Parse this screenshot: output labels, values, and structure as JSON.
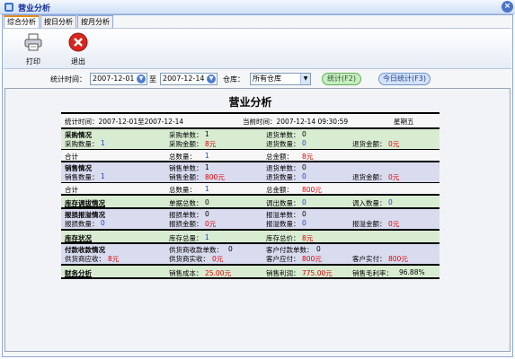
{
  "window": {
    "title": "营业分析"
  },
  "tabs": [
    "综合分析",
    "按日分析",
    "按月分析"
  ],
  "toolbar": {
    "print": "打印",
    "exit": "退出"
  },
  "filter": {
    "time_label": "统计时间：",
    "start_date": "2007-12-01",
    "to_label": "至",
    "end_date": "2007-12-14",
    "warehouse_label": "仓库：",
    "warehouse_value": "所有仓库",
    "stat_button": "统计(F2)",
    "today_button": "今日统计(F3)"
  },
  "report": {
    "title": "营业分析",
    "period": "统计时间：2007-12-01至2007-12-14",
    "now": "当前时间：2007-12-14 09:30:59",
    "weekday": "星期五",
    "purchase": {
      "heading": "采购情况",
      "count_label": "采购单数：",
      "count": "1",
      "return_count_label": "退货单数：",
      "return_count": "0",
      "qty_label": "采购数量：",
      "qty": "1",
      "amount_label": "采购金额：",
      "amount": "8元",
      "return_qty_label": "退货数量：",
      "return_qty": "0",
      "return_amount_label": "退货金额：",
      "return_amount": "0元",
      "total_label": "合计",
      "total_qty_label": "总数量：",
      "total_qty": "1",
      "total_amount_label": "总金额：",
      "total_amount": "8元"
    },
    "sales": {
      "heading": "销售情况",
      "count_label": "销售单数：",
      "count": "1",
      "return_count_label": "退货单数：",
      "return_count": "0",
      "qty_label": "销售数量：",
      "qty": "1",
      "amount_label": "销售金额：",
      "amount": "800元",
      "return_qty_label": "退货数量：",
      "return_qty": "0",
      "return_amount_label": "退货金额：",
      "return_amount": "0元",
      "total_label": "合计",
      "total_qty_label": "总数量：",
      "total_qty": "1",
      "total_amount_label": "总金额：",
      "total_amount": "800元"
    },
    "transfer": {
      "heading": "库存调拔情况",
      "total_label": "单据总数：",
      "total": "0",
      "out_label": "调出数量：",
      "out": "0",
      "in_label": "调入数量：",
      "in": "0"
    },
    "loss": {
      "heading": "报损报溢情况",
      "loss_count_label": "报损单数：",
      "loss_count": "0",
      "over_count_label": "报溢单数：",
      "over_count": "0",
      "loss_qty_label": "报损数量：",
      "loss_qty": "0",
      "loss_amount_label": "报损金额：",
      "loss_amount": "0元",
      "over_qty_label": "报溢数量：",
      "over_qty": "0",
      "over_amount_label": "报溢金额：",
      "over_amount": "0元"
    },
    "stock": {
      "heading": "库存状况",
      "total_label": "库存总量：",
      "total": "1",
      "value_label": "库存总价：",
      "value": "8元"
    },
    "payment": {
      "heading": "付款收款情况",
      "supplier_count_label": "供货商收款单数：",
      "supplier_count": "0",
      "customer_count_label": "客户付款单数：",
      "customer_count": "0",
      "supplier_due_label": "供货商应收：",
      "supplier_due": "8元",
      "supplier_paid_label": "供货商实收：",
      "supplier_paid": "0元",
      "customer_due_label": "客户应付：",
      "customer_due": "800元",
      "customer_paid_label": "客户实付：",
      "customer_paid": "800元"
    },
    "finance": {
      "heading": "财务分析",
      "cost_label": "销售成本：",
      "cost": "25.00元",
      "profit_label": "销售利润：",
      "profit": "775.00元",
      "margin_label": "销售毛利率：",
      "margin": "96.88%"
    }
  }
}
